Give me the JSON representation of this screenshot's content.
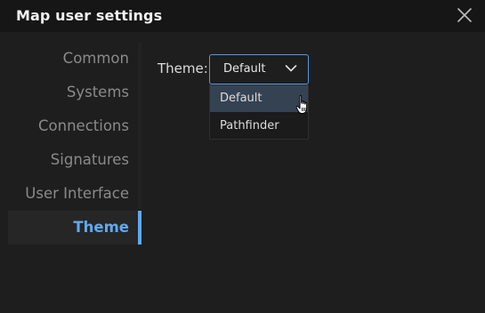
{
  "window": {
    "title": "Map user settings",
    "close_icon": "close-icon"
  },
  "sidebar": {
    "items": [
      {
        "label": "Common",
        "active": false
      },
      {
        "label": "Systems",
        "active": false
      },
      {
        "label": "Connections",
        "active": false
      },
      {
        "label": "Signatures",
        "active": false
      },
      {
        "label": "User Interface",
        "active": false
      },
      {
        "label": "Theme",
        "active": true
      }
    ],
    "accent_color": "#60a9ef"
  },
  "theme_setting": {
    "label": "Theme:",
    "selected": "Default",
    "chevron_icon": "chevron-down-icon",
    "options": [
      {
        "label": "Default",
        "hovered": true
      },
      {
        "label": "Pathfinder",
        "hovered": false
      }
    ],
    "cursor_icon": "hand-pointer-icon"
  },
  "colors": {
    "background": "#1e1e1e",
    "titlebar": "#161616",
    "focus_border": "#4e9be6",
    "option_hover": "#354252"
  }
}
